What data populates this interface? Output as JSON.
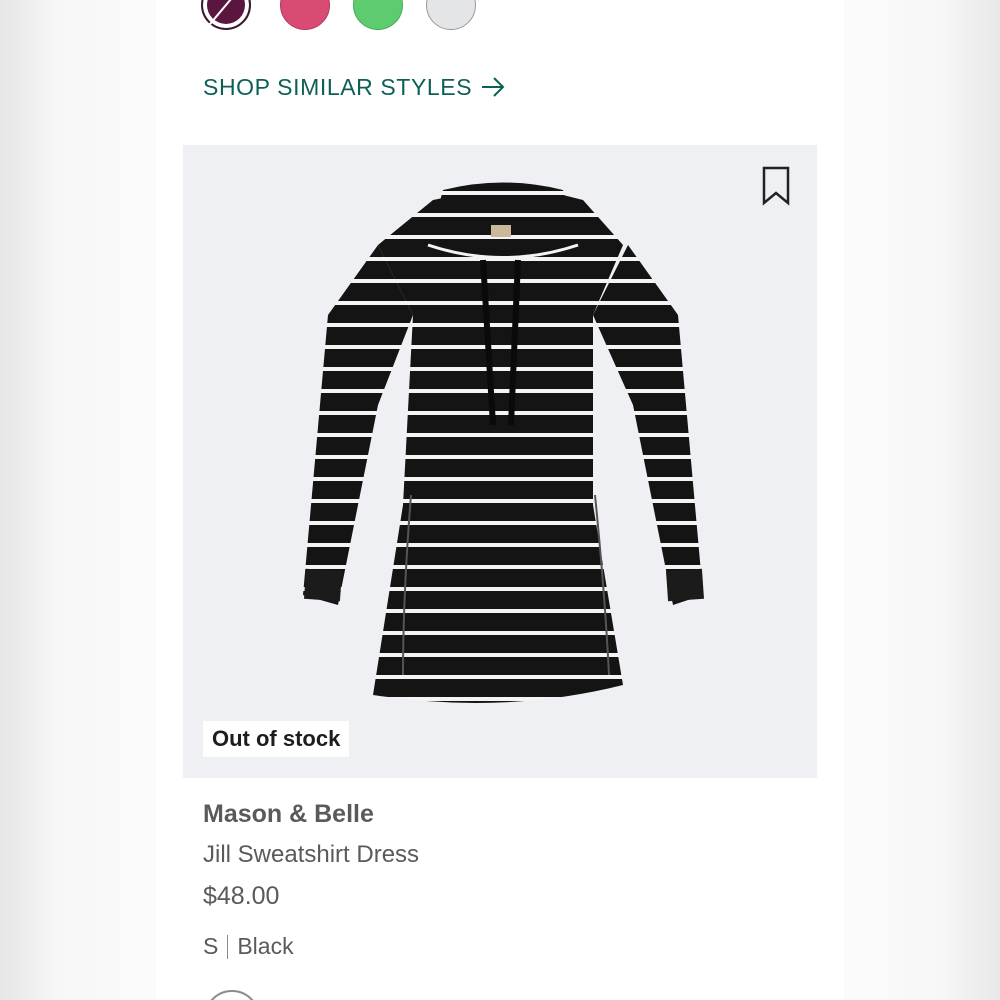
{
  "swatches": [
    {
      "name": "plum",
      "color": "#5b1640",
      "selected": true
    },
    {
      "name": "raspberry",
      "color": "#d94b73",
      "selected": false
    },
    {
      "name": "green",
      "color": "#5ecb6e",
      "selected": false
    },
    {
      "name": "light-grey",
      "color": "#e4e5e7",
      "selected": false
    }
  ],
  "shop_similar": {
    "label": "SHOP SIMILAR STYLES",
    "icon": "arrow-right-icon"
  },
  "product": {
    "bookmark_icon": "bookmark-icon",
    "stock_badge": "Out of stock",
    "brand": "Mason & Belle",
    "name": "Jill Sweatshirt Dress",
    "price": "$48.00",
    "size": "S",
    "color": "Black"
  },
  "colors": {
    "accent": "#0d5f57",
    "card_background": "#eef0f3",
    "text": "#5a5a5a"
  }
}
